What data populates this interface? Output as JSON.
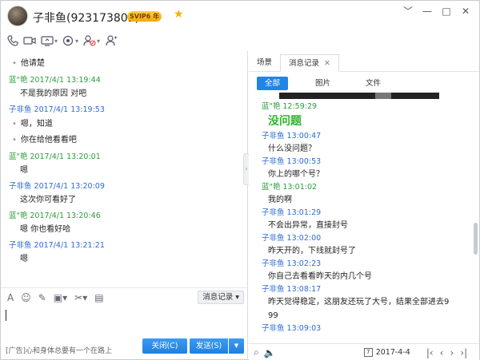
{
  "window": {
    "title": "子非鱼(923173805)",
    "badge": "SVIP6 年",
    "colors": {
      "accent": "#1f86e5",
      "green_name": "#2d9d3c",
      "blue_name": "#2b6bd6"
    }
  },
  "window_buttons": [
    "﹀",
    "—",
    "□",
    "✕"
  ],
  "toolbar_icons": [
    "phone-icon",
    "video-icon",
    "screen-share-icon",
    "remote-assist-icon",
    "add-member-icon",
    "more-icon"
  ],
  "chat": {
    "messages": [
      {
        "type": "bullet",
        "text": "他请楚"
      },
      {
        "type": "head",
        "color": "green",
        "text": "蓝\"艳 2017/4/1 13:19:44"
      },
      {
        "type": "body",
        "text": "不是我的原因 对吧"
      },
      {
        "type": "head",
        "color": "blue",
        "text": "子非鱼 2017/4/1 13:19:53"
      },
      {
        "type": "bullet",
        "text": "嗯，知道"
      },
      {
        "type": "bullet",
        "text": "你在给他看看吧"
      },
      {
        "type": "head",
        "color": "green",
        "text": "蓝\"艳 2017/4/1 13:20:01"
      },
      {
        "type": "body",
        "text": "嗯"
      },
      {
        "type": "head",
        "color": "blue",
        "text": "子非鱼 2017/4/1 13:20:09"
      },
      {
        "type": "body",
        "text": "这次你可看好了"
      },
      {
        "type": "head",
        "color": "green",
        "text": "蓝\"艳 2017/4/1 13:20:46"
      },
      {
        "type": "body",
        "text": "嗯 你也看好哈"
      },
      {
        "type": "head",
        "color": "blue",
        "text": "子非鱼 2017/4/1 13:21:21"
      },
      {
        "type": "body",
        "text": "嗯"
      }
    ],
    "history_button": "消息记录",
    "ad_text": "[广告]心和身体总要有一个在路上",
    "close_button": "关闭(C)",
    "send_button": "发送(S)"
  },
  "history": {
    "tabs": [
      {
        "label": "场景"
      },
      {
        "label": "消息记录"
      }
    ],
    "filters": [
      "全部",
      "图片",
      "文件"
    ],
    "entries": [
      {
        "head": "蓝\"艳 12:59:29",
        "color": "green",
        "body": "没问题",
        "big": true
      },
      {
        "head": "子非鱼 13:00:47",
        "color": "blue",
        "body": "什么没问题？"
      },
      {
        "head": "子非鱼 13:00:53",
        "color": "blue",
        "body": "你上的哪个号？"
      },
      {
        "head": "蓝\"艳 13:01:02",
        "color": "green",
        "body": "我的啊"
      },
      {
        "head": "子非鱼 13:01:29",
        "color": "blue",
        "body": "不会出异常，直接封号"
      },
      {
        "head": "子非鱼 13:02:00",
        "color": "blue",
        "body": "昨天开的，下线就封号了"
      },
      {
        "head": "子非鱼 13:02:23",
        "color": "blue",
        "body": "你自己去看看昨天的内几个号"
      },
      {
        "head": "子非鱼 13:08:17",
        "color": "blue",
        "body": "昨天觉得稳定，这朋友还玩了大号，结果全部进去9",
        "body2": "99"
      },
      {
        "head": "子非鱼 13:09:03",
        "color": "blue",
        "body": ""
      }
    ],
    "date": "2017-4-4",
    "cal_day": "7"
  }
}
